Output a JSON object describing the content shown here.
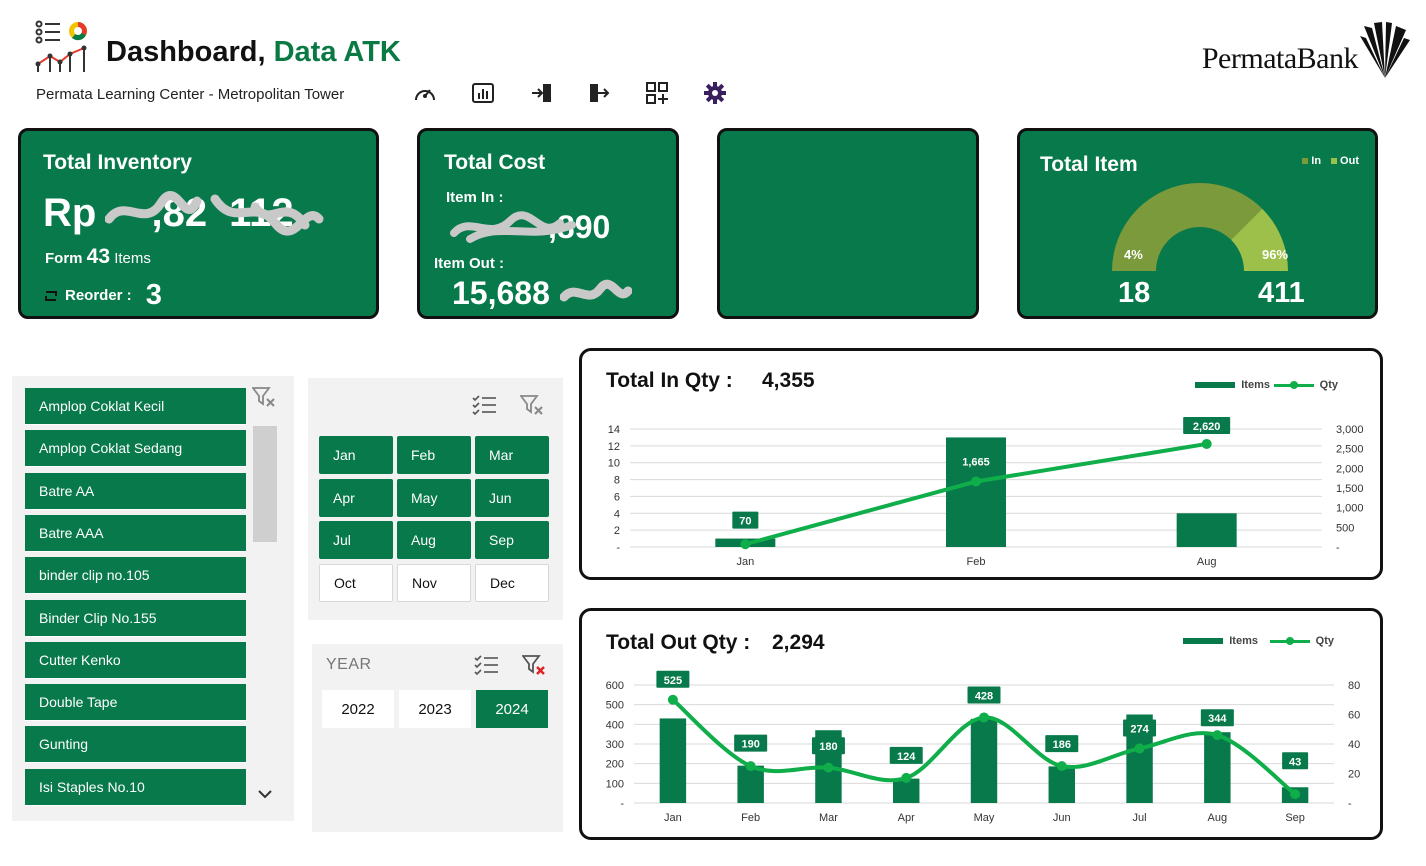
{
  "header": {
    "title_prefix": "Dashboard,",
    "title_accent": "Data ATK",
    "subtitle": "Permata Learning Center - Metropolitan Tower",
    "brand": "PermataBank",
    "toolbar_icons": [
      "speedometer-icon",
      "bar-chart-icon",
      "login-icon",
      "logout-icon",
      "add-grid-icon",
      "gear-icon"
    ]
  },
  "colors": {
    "primary": "#08794a",
    "line": "#0fae4b",
    "gauge_in": "#7a9a3c",
    "gauge_out": "#9dc04a"
  },
  "total_inventory": {
    "title": "Total Inventory",
    "currency": "Rp",
    "value_visible": ",82",
    "value_tail": "112",
    "form_label": "Form",
    "form_count": "43",
    "form_unit": "Items",
    "reorder_label": "Reorder :",
    "reorder_count": "3"
  },
  "total_cost": {
    "title": "Total Cost",
    "in_label": "Item In :",
    "in_value_visible": ",890",
    "out_label": "Item Out :",
    "out_value_visible": "15,688"
  },
  "total_item": {
    "title": "Total Item",
    "legend_in": "In",
    "legend_out": "Out",
    "pct_in": "4%",
    "pct_out": "96%",
    "share_in": 0.04,
    "count_in": "18",
    "count_out": "411"
  },
  "item_slicer": {
    "items": [
      "Amplop Coklat Kecil",
      "Amplop Coklat Sedang",
      "Batre AA",
      "Batre AAA",
      "binder clip no.105",
      "Binder Clip No.155",
      "Cutter Kenko",
      "Double Tape",
      "Gunting",
      "Isi Staples No.10"
    ]
  },
  "month_slicer": {
    "months": [
      {
        "label": "Jan",
        "selected": true
      },
      {
        "label": "Feb",
        "selected": true
      },
      {
        "label": "Mar",
        "selected": true
      },
      {
        "label": "Apr",
        "selected": true
      },
      {
        "label": "May",
        "selected": true
      },
      {
        "label": "Jun",
        "selected": true
      },
      {
        "label": "Jul",
        "selected": true
      },
      {
        "label": "Aug",
        "selected": true
      },
      {
        "label": "Sep",
        "selected": true
      },
      {
        "label": "Oct",
        "selected": false
      },
      {
        "label": "Nov",
        "selected": false
      },
      {
        "label": "Dec",
        "selected": false
      }
    ]
  },
  "year_slicer": {
    "label": "YEAR",
    "years": [
      {
        "label": "2022",
        "selected": false
      },
      {
        "label": "2023",
        "selected": false
      },
      {
        "label": "2024",
        "selected": true
      }
    ]
  },
  "chart_data": [
    {
      "type": "bar",
      "title": "Total In Qty :",
      "total": "4,355",
      "categories": [
        "Jan",
        "Feb",
        "Aug"
      ],
      "series": [
        {
          "name": "Items",
          "axis": "left",
          "values": [
            1,
            13,
            4
          ]
        },
        {
          "name": "Qty",
          "type": "line",
          "axis": "right",
          "values": [
            70,
            1665,
            2620
          ],
          "labels": [
            "70",
            "1,665",
            "2,620"
          ]
        }
      ],
      "ylim": [
        0,
        14
      ],
      "yticks": [
        "-",
        "2",
        "4",
        "6",
        "8",
        "10",
        "12",
        "14"
      ],
      "y2lim": [
        0,
        3000
      ],
      "y2ticks": [
        "-",
        "500",
        "1,000",
        "1,500",
        "2,000",
        "2,500",
        "3,000"
      ],
      "legend_position": "top-right",
      "grid": true
    },
    {
      "type": "bar",
      "title": "Total Out Qty :",
      "total": "2,294",
      "categories": [
        "Jan",
        "Feb",
        "Mar",
        "Apr",
        "May",
        "Jun",
        "Jul",
        "Aug",
        "Sep"
      ],
      "series": [
        {
          "name": "Items",
          "axis": "left",
          "values": [
            430,
            190,
            370,
            124,
            428,
            186,
            450,
            360,
            80
          ],
          "labels": [
            "525",
            "190",
            "180",
            "124",
            "428",
            "186",
            "274",
            "344",
            "43"
          ]
        },
        {
          "name": "Qty",
          "type": "line",
          "axis": "right",
          "values": [
            70,
            25,
            24,
            17,
            58,
            25,
            37,
            46,
            6
          ]
        }
      ],
      "ylim": [
        0,
        600
      ],
      "yticks": [
        "-",
        "100",
        "200",
        "300",
        "400",
        "500",
        "600"
      ],
      "y2lim": [
        0,
        80
      ],
      "y2ticks": [
        "-",
        "20",
        "40",
        "60",
        "80"
      ],
      "legend_position": "top-right",
      "grid": true
    }
  ]
}
